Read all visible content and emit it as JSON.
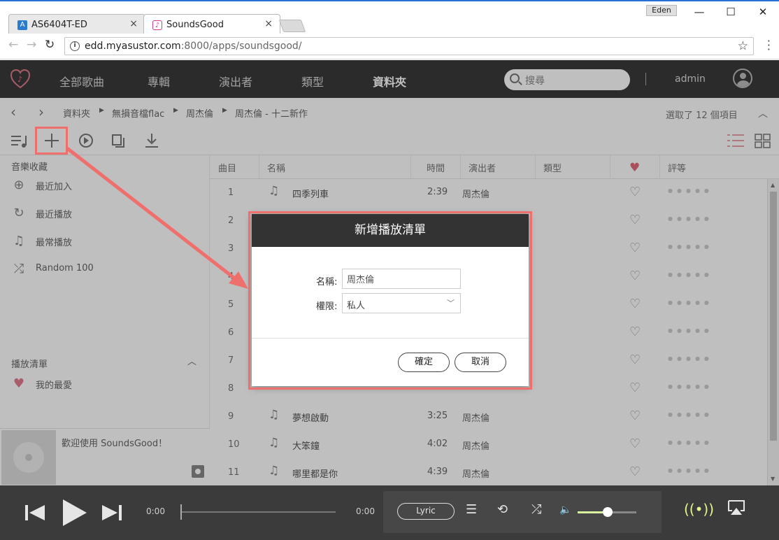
{
  "browser": {
    "tabs": [
      {
        "label": "AS6404T-ED",
        "close": "×"
      },
      {
        "label": "SoundsGood",
        "close": "×"
      }
    ],
    "profile": "Eden",
    "window_controls": {
      "minimize": "—",
      "maximize": "☐",
      "close": "✕"
    },
    "url_host": "edd.myasustor.com",
    "url_rest": ":8000/apps/soundsgood/"
  },
  "app": {
    "nav": [
      "全部歌曲",
      "專輯",
      "演出者",
      "類型",
      "資料夾"
    ],
    "active_nav": "資料夾",
    "search_placeholder": "搜尋",
    "user": "admin",
    "breadcrumb": [
      "資料夾",
      "無損音檔flac",
      "周杰倫",
      "周杰倫 - 十二新作"
    ],
    "selection_info": "選取了 12 個項目",
    "sidebar": {
      "favorites_heading": "音樂收藏",
      "favorites": [
        "最近加入",
        "最近播放",
        "最常播放",
        "Random 100"
      ],
      "playlists_heading": "播放清單",
      "playlists": [
        "我的最愛"
      ]
    },
    "nowplaying_text": "歡迎使用 SoundsGood！",
    "table": {
      "headers": {
        "track": "曲目",
        "name": "名稱",
        "time": "時間",
        "artist": "演出者",
        "genre": "類型",
        "rating": "評等"
      },
      "rows": [
        {
          "num": "1",
          "title": "四季列車",
          "time": "2:39",
          "artist": "周杰倫"
        },
        {
          "num": "2",
          "title": "",
          "time": "",
          "artist": ""
        },
        {
          "num": "3",
          "title": "",
          "time": "",
          "artist": ""
        },
        {
          "num": "4",
          "title": "",
          "time": "",
          "artist": ""
        },
        {
          "num": "5",
          "title": "",
          "time": "",
          "artist": ""
        },
        {
          "num": "6",
          "title": "",
          "time": "",
          "artist": ""
        },
        {
          "num": "7",
          "title": "",
          "time": "",
          "artist": ""
        },
        {
          "num": "8",
          "title": "",
          "time": "",
          "artist": ""
        },
        {
          "num": "9",
          "title": "夢想啟動",
          "time": "3:25",
          "artist": "周杰倫"
        },
        {
          "num": "10",
          "title": "大笨鐘",
          "time": "4:02",
          "artist": "周杰倫"
        },
        {
          "num": "11",
          "title": "哪里都是你",
          "time": "4:39",
          "artist": "周杰倫"
        }
      ]
    },
    "player": {
      "time_current": "0:00",
      "time_total": "0:00",
      "lyric_label": "Lyric",
      "volume_level": 0.5,
      "progress": 0
    }
  },
  "dialog": {
    "title": "新增播放清單",
    "name_label": "名稱:",
    "name_value": "周杰倫",
    "permission_label": "權限:",
    "permission_value": "私人",
    "ok": "確定",
    "cancel": "取消"
  },
  "colors": {
    "annotation": "#ef6f6c",
    "accent_heart": "#e06b7c",
    "volume_fill": "#d8f2a0",
    "cast_icon": "#e6f58a"
  },
  "icons": {
    "add_to_playlist": "plus-icon",
    "queue": "queue-music-icon",
    "play": "play-circle-icon",
    "copy": "copy-icon",
    "download": "download-icon",
    "list_view": "list-view-icon",
    "grid_view": "grid-view-icon"
  }
}
